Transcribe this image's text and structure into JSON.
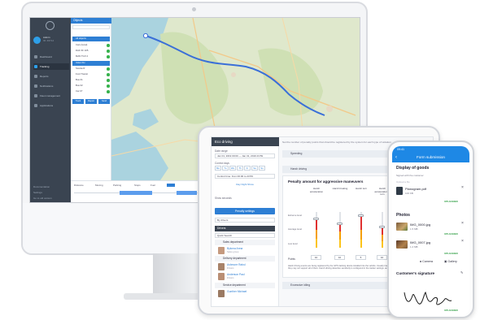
{
  "desktop": {
    "sidebar": {
      "user_name": "Admin",
      "user_sub": "ID: 46714",
      "nav": [
        "Dashboard",
        "Tracking",
        "Reports",
        "Notifications",
        "Fleet management",
        "Applications"
      ],
      "bottom": [
        "Documentation",
        "Settings",
        "Go to old version"
      ]
    },
    "objects": {
      "title": "Objects",
      "rows": [
        "",
        "All objects",
        "Cars (local)",
        "DAF XF 105",
        "MAN TGX 2",
        "Volvo FH",
        "Scania R",
        "Ford Transit",
        "Bus 01",
        "Bus 02",
        "Car 07"
      ],
      "buttons": [
        "Track",
        "Report",
        "Send"
      ]
    },
    "timeline": {
      "labels": [
        "Distance",
        "Moving",
        "Parking",
        "Stops",
        "Fuel"
      ]
    }
  },
  "tablet": {
    "left": {
      "title": "Eco driving",
      "date_range_label": "Date range",
      "date_range_value": "Jan 01, 2019 00:00 — Jan 31, 2019 23:59",
      "control_days_label": "Control days",
      "days": [
        "Mo",
        "Tu",
        "We",
        "Th",
        "Fr",
        "Sa",
        "Su"
      ],
      "shift_label": "Control time: from 00:00 to 23:59",
      "day_night": "Day  Night  Show",
      "show_seconds": "Show seconds",
      "penalty_button": "Penalty settings",
      "by_drivers": "By drivers",
      "drivers_header": "Drivers",
      "quick_search": "Quick Search",
      "departments": [
        {
          "name": "Sales department",
          "drivers": [
            {
              "name": "Bykova Anna",
              "group": "Sales group"
            }
          ]
        },
        {
          "name": "Delivery department",
          "drivers": [
            {
              "name": "Ashmore Rahul",
              "group": "Drivers"
            },
            {
              "name": "Anderson Paul",
              "group": "Drivers"
            }
          ]
        },
        {
          "name": "Service department",
          "drivers": [
            {
              "name": "Gunther Michael",
              "group": ""
            }
          ]
        }
      ]
    },
    "right": {
      "top_note": "Set the number of penalty points that should be registered by the system for each type of violation",
      "sections": [
        "Speeding",
        "Harsh driving",
        "Excessive idling"
      ],
      "card_title": "Penalty amount for aggressive maneuvers",
      "columns": [
        "Harsh acceleration",
        "Harsh braking",
        "Harsh turn",
        "Harsh acceleration in turn",
        "Ha"
      ],
      "levels": [
        "Extreme level",
        "Average level",
        "Low level"
      ],
      "points_label": "Points",
      "points": [
        "10",
        "10",
        "5",
        "10",
        "5"
      ],
      "note": "Harsh driving events are being registered by the GPS tracking device installed into the vehicle. Usually trackers support several types of events, so they may not support all of them. Harsh driving detection sensitivity is configured in the tracker settings, and not in this penalty system."
    }
  },
  "phone": {
    "status_time": "09:41",
    "header_title": "Form submission",
    "goods_title": "Display of goods",
    "signed_text": "Signed with the customer",
    "file_note": "Upload a file",
    "file_name": "Planogram.pdf",
    "file_size": "100 KB",
    "photos_title": "Photos",
    "photos": [
      {
        "name": "IMG_0000.jpg",
        "size": "1.5 MB"
      },
      {
        "name": "IMG_0007.jpg",
        "size": "1.2 MB"
      }
    ],
    "uploaded": "UPLOADED",
    "camera_label": "Camera",
    "gallery_label": "Gallery",
    "signature_title": "Customer's signature"
  },
  "colors": {
    "accent": "#2e7fd4",
    "sidebar": "#3a4451",
    "success": "#2f9e44",
    "route": "#3a6fd8"
  }
}
